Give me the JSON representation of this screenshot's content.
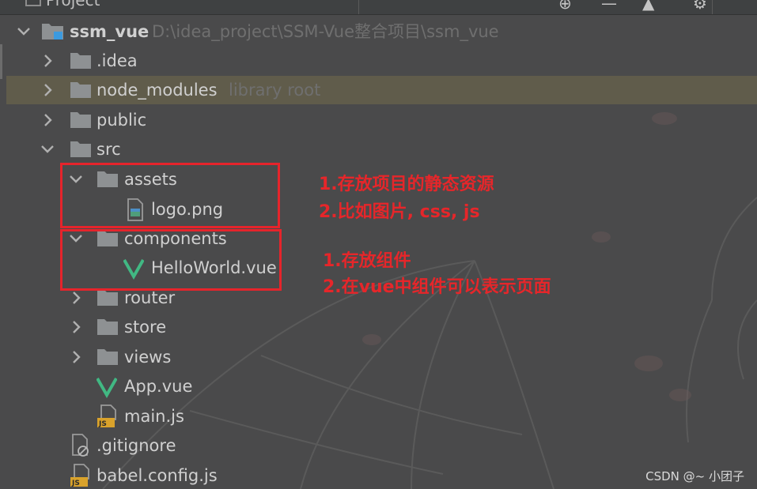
{
  "panel": {
    "title": "Project"
  },
  "tree": {
    "root": {
      "name": "ssm_vue",
      "path": "D:\\idea_project\\SSM-Vue整合项目\\ssm_vue"
    },
    "items": {
      "idea": {
        "name": ".idea"
      },
      "node_modules": {
        "name": "node_modules",
        "hint": "library root"
      },
      "public": {
        "name": "public"
      },
      "src": {
        "name": "src"
      },
      "assets": {
        "name": "assets"
      },
      "logo": {
        "name": "logo.png"
      },
      "components": {
        "name": "components"
      },
      "helloworld": {
        "name": "HelloWorld.vue"
      },
      "router": {
        "name": "router"
      },
      "store": {
        "name": "store"
      },
      "views": {
        "name": "views"
      },
      "app": {
        "name": "App.vue"
      },
      "main": {
        "name": "main.js"
      },
      "gitignore": {
        "name": ".gitignore"
      },
      "babel": {
        "name": "babel.config.js"
      }
    }
  },
  "annotations": {
    "assets": {
      "line1": "1.存放项目的静态资源",
      "line2": "2.比如图片, css, js"
    },
    "components": {
      "line1": "1.存放组件",
      "line2": "2.在vue中组件可以表示页面"
    }
  },
  "watermark": "CSDN @~ 小团子",
  "colors": {
    "background": "#4a4a4b",
    "text": "#d0d0d0",
    "folder": "#8e9193",
    "vue_green": "#41b883",
    "annotation_red": "#e6242b",
    "selection": "#7d734b"
  },
  "icons": {
    "chevron_right": "chevron-right-icon",
    "chevron_down": "chevron-down-icon",
    "folder": "folder-icon",
    "module": "module-folder-icon",
    "image": "image-file-icon",
    "vue": "vue-file-icon",
    "js": "js-file-icon",
    "ignore": "ignore-file-icon"
  }
}
